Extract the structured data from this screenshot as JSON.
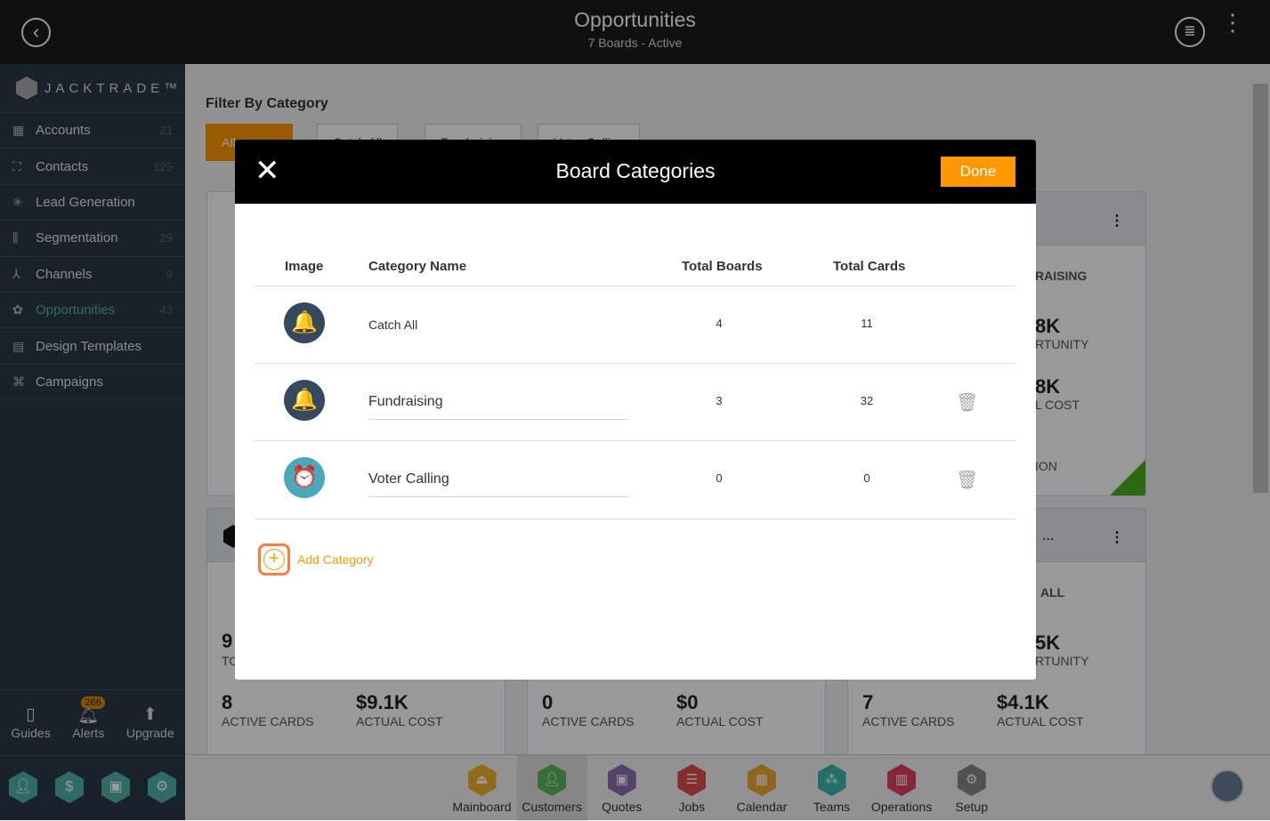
{
  "header": {
    "title": "Opportunities",
    "subtitle": "7 Boards - Active"
  },
  "sidebar": {
    "brand": "JACKTRADE™",
    "items": [
      {
        "label": "Accounts",
        "count": "21",
        "icon": "building-icon"
      },
      {
        "label": "Contacts",
        "count": "125",
        "icon": "contacts-icon"
      },
      {
        "label": "Lead Generation",
        "count": "",
        "icon": "lead-icon"
      },
      {
        "label": "Segmentation",
        "count": "29",
        "icon": "segmentation-icon"
      },
      {
        "label": "Channels",
        "count": "9",
        "icon": "channels-icon"
      },
      {
        "label": "Opportunities",
        "count": "43",
        "icon": "opportunities-icon",
        "active": true
      },
      {
        "label": "Design Templates",
        "count": "",
        "icon": "templates-icon"
      },
      {
        "label": "Campaigns",
        "count": "",
        "icon": "campaigns-icon"
      }
    ],
    "bottom": [
      {
        "label": "Guides"
      },
      {
        "label": "Alerts",
        "badge": "266"
      },
      {
        "label": "Upgrade"
      }
    ]
  },
  "main": {
    "filter_label": "Filter By Category",
    "chips": [
      "All",
      "Catch All",
      "Fundraising",
      "Voter Calling"
    ],
    "cards": {
      "r1": {
        "cat": "RAISING",
        "v1": "8K",
        "l1": "RTUNITY",
        "v2": "8K",
        "l2": "L COST",
        "l3": "ION"
      },
      "r2a": {
        "n1": "9",
        "l1": "TO",
        "n2": "8",
        "l2": "ACTIVE CARDS",
        "n3": "$9.1K",
        "l3": "ACTUAL COST"
      },
      "r2b": {
        "n2": "0",
        "l2": "ACTIVE CARDS",
        "n3": "$0",
        "l3": "ACTUAL COST"
      },
      "r2c": {
        "title": "...",
        "cat": "ALL",
        "v1": "5K",
        "l1": "RTUNITY",
        "n2": "7",
        "l2": "ACTIVE CARDS",
        "n3": "$4.1K",
        "l3": "ACTUAL COST"
      }
    }
  },
  "dock": [
    "Mainboard",
    "Customers",
    "Quotes",
    "Jobs",
    "Calendar",
    "Teams",
    "Operations",
    "Setup"
  ],
  "dock_colors": [
    "#f0b429",
    "#5cb85c",
    "#8e6fb5",
    "#e04b4b",
    "#f0a830",
    "#3bb7b0",
    "#e0405a",
    "#888888"
  ],
  "modal": {
    "title": "Board Categories",
    "done": "Done",
    "columns": [
      "Image",
      "Category Name",
      "Total Boards",
      "Total Cards"
    ],
    "rows": [
      {
        "name": "Catch All",
        "boards": "4",
        "cards": "11",
        "icon": "bell-icon"
      },
      {
        "name": "Fundraising",
        "boards": "3",
        "cards": "32",
        "icon": "bell-icon"
      },
      {
        "name": "Voter Calling",
        "boards": "0",
        "cards": "0",
        "icon": "alarm-clock-icon"
      }
    ],
    "add": "Add Category"
  },
  "accent": "#ff9800"
}
